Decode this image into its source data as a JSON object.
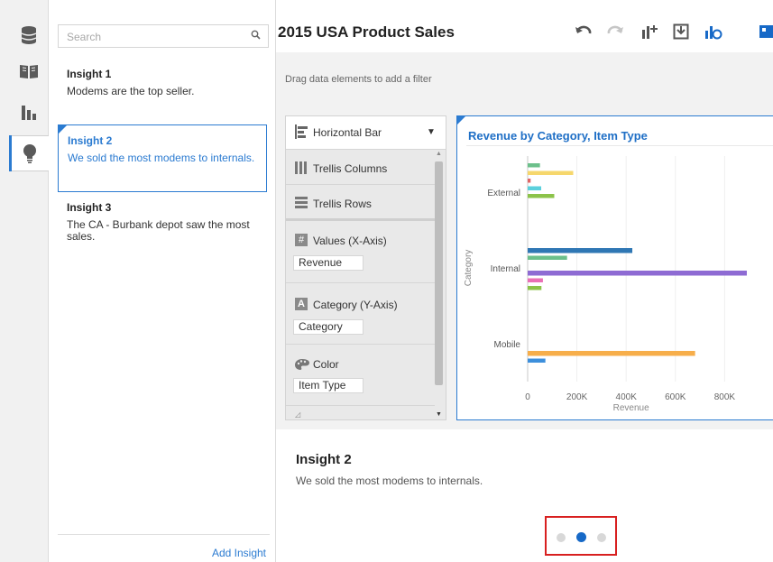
{
  "rail": {
    "items": [
      {
        "icon": "data-icon"
      },
      {
        "icon": "book-icon"
      },
      {
        "icon": "visualize-icon"
      },
      {
        "icon": "insight-bulb-icon"
      }
    ]
  },
  "search": {
    "placeholder": "Search"
  },
  "insights": [
    {
      "title": "Insight 1",
      "desc": "Modems are the top seller."
    },
    {
      "title": "Insight 2",
      "desc": "We sold the most modems to internals."
    },
    {
      "title": "Insight 3",
      "desc": "The CA - Burbank depot saw the most sales."
    }
  ],
  "add_insight_label": "Add Insight",
  "main": {
    "title": "2015 USA Product Sales",
    "filter_hint": "Drag data elements to add a filter"
  },
  "grammar": {
    "chart_type": "Horizontal Bar",
    "trellis_columns": "Trellis Columns",
    "trellis_rows": "Trellis Rows",
    "values_label": "Values (X-Axis)",
    "values_field": "Revenue",
    "category_label": "Category (Y-Axis)",
    "category_field": "Category",
    "color_label": "Color",
    "color_field": "Item Type"
  },
  "chart_data": {
    "type": "bar",
    "orientation": "horizontal",
    "title": "Revenue by Category, Item Type",
    "xlabel": "Revenue",
    "ylabel": "Category",
    "xlim": [
      0,
      900000
    ],
    "x_ticks": [
      "0",
      "200K",
      "400K",
      "600K",
      "800K"
    ],
    "x_tick_values": [
      0,
      200000,
      400000,
      600000,
      800000
    ],
    "groups": [
      {
        "category": "External",
        "bars": [
          {
            "value": 50000,
            "color": "#6cc08b"
          },
          {
            "value": 185000,
            "color": "#f6d76c"
          },
          {
            "value": 12000,
            "color": "#e06666"
          },
          {
            "value": 55000,
            "color": "#5bd0dc"
          },
          {
            "value": 108000,
            "color": "#8cc34a"
          }
        ]
      },
      {
        "category": "Internal",
        "bars": [
          {
            "value": 425000,
            "color": "#2f77b4"
          },
          {
            "value": 160000,
            "color": "#6cc08b"
          },
          {
            "value": 890000,
            "color": "#8e6bd3"
          },
          {
            "value": 62000,
            "color": "#ea6fb5"
          },
          {
            "value": 56000,
            "color": "#8cc34a"
          }
        ]
      },
      {
        "category": "Mobile",
        "bars": [
          {
            "value": 680000,
            "color": "#f7ae4a"
          },
          {
            "value": 72000,
            "color": "#3d8fdc"
          }
        ]
      }
    ]
  },
  "bottom_insight": {
    "title": "Insight 2",
    "desc": "We sold the most modems to internals."
  },
  "pager": {
    "count": 3,
    "active_index": 1
  }
}
